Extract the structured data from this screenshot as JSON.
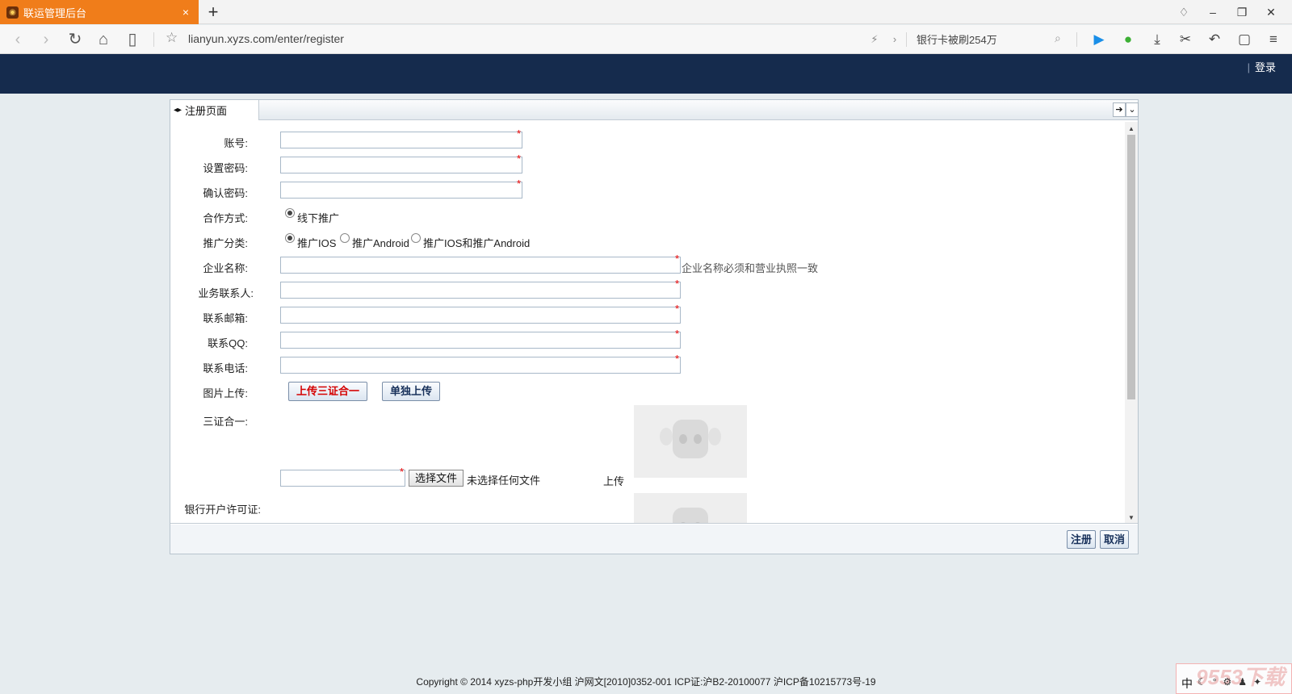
{
  "browser": {
    "tab_title": "联运管理后台",
    "tab_close": "×",
    "new_tab": "+",
    "url": "lianyun.xyzs.com/enter/register",
    "search_text": "银行卡被刷254万"
  },
  "header": {
    "login": "登录"
  },
  "panel": {
    "tab_label": "注册页面"
  },
  "form": {
    "account_label": "账号:",
    "password_label": "设置密码:",
    "confirm_label": "确认密码:",
    "coop_label": "合作方式:",
    "coop_option": "线下推广",
    "category_label": "推广分类:",
    "category_options": [
      "推广IOS",
      "推广Android",
      "推广IOS和推广Android"
    ],
    "category_selected": "推广IOS",
    "company_label": "企业名称:",
    "company_hint": "企业名称必须和营业执照一致",
    "contact_label": "业务联系人:",
    "email_label": "联系邮箱:",
    "qq_label": "联系QQ:",
    "phone_label": "联系电话:",
    "image_label": "图片上传:",
    "upload_combined": "上传三证合一",
    "upload_separate": "单独上传",
    "three_in_one_label": "三证合一:",
    "choose_file": "选择文件",
    "no_file": "未选择任何文件",
    "upload": "上传",
    "bank_label": "银行开户许可证:",
    "required_mark": "*"
  },
  "footer_buttons": {
    "register": "注册",
    "cancel": "取消"
  },
  "copyright": "Copyright © 2014 xyzs-php开发小组 沪网文[2010]0352-001 ICP证:沪B2-20100077 沪ICP备10215773号-19",
  "watermark": {
    "brand": "9553下载",
    "ime": "中"
  },
  "colors": {
    "tab_orange": "#f07d1a",
    "header_navy": "#152b4d",
    "required_red": "#e00000",
    "upload_red": "#d40000"
  }
}
